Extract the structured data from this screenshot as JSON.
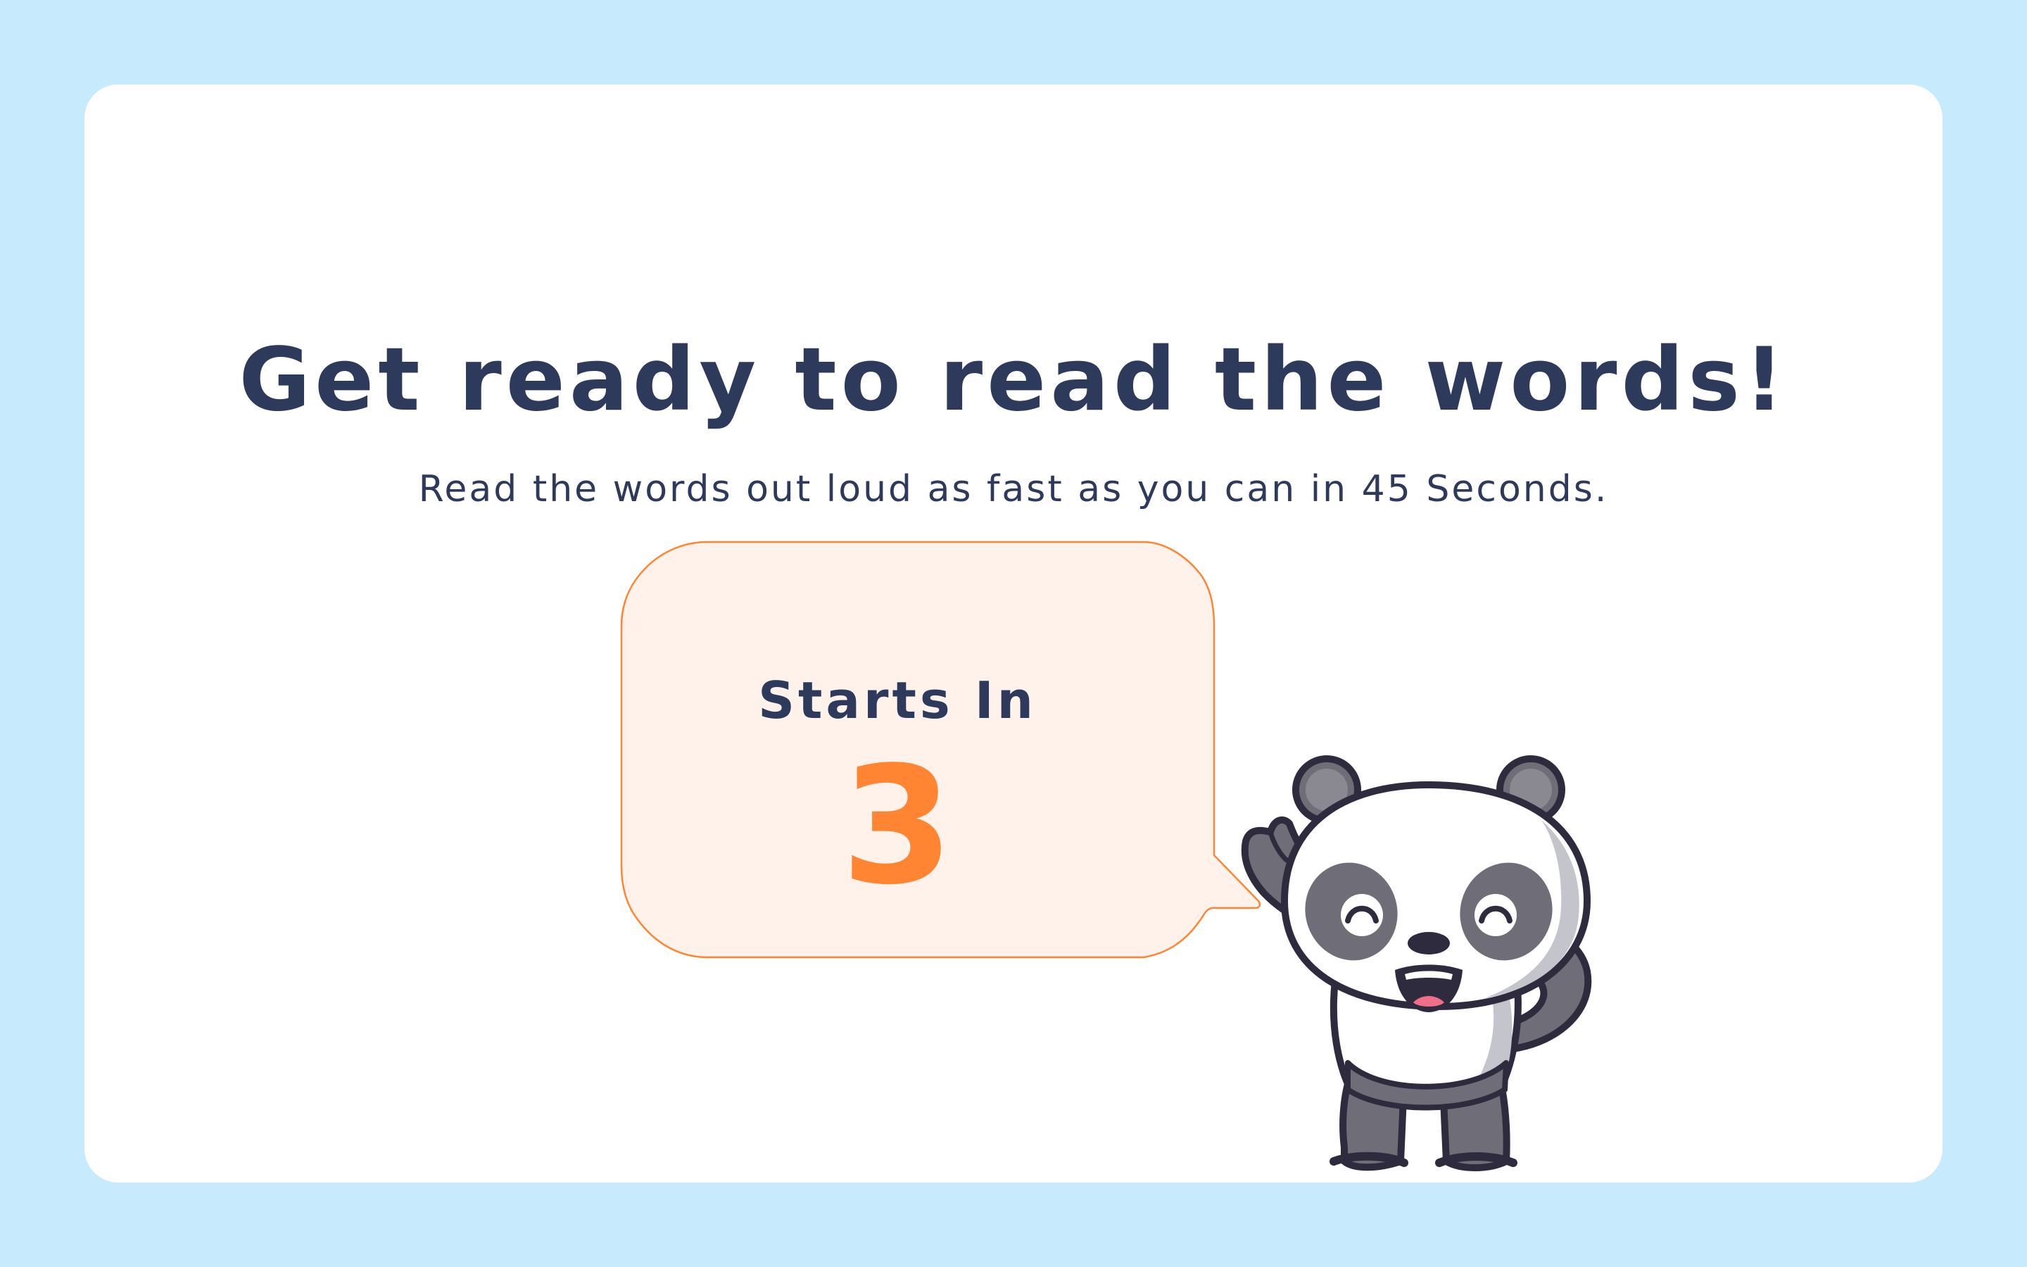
{
  "intro": {
    "title": "Get ready to read the words!",
    "subtitle": "Read the words out loud as fast as you can in 45 Seconds."
  },
  "countdown": {
    "label": "Starts In",
    "value": "3"
  },
  "mascot": {
    "icon": "panda-mascot-icon"
  },
  "colors": {
    "background": "#c7ebfd",
    "card": "#ffffff",
    "text": "#2e3a5c",
    "accent": "#ff8533",
    "bubble_fill": "#fff2ea",
    "bubble_border": "#ff8533"
  }
}
